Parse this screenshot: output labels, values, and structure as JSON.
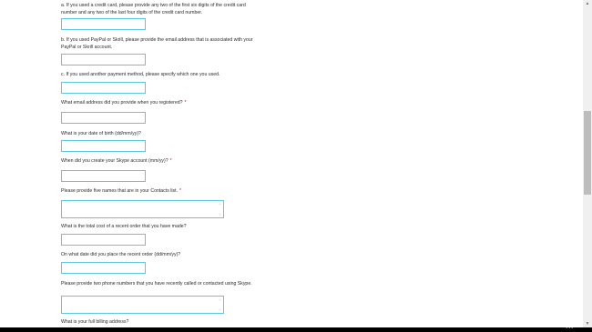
{
  "form": {
    "q_card": {
      "label": "a. If you used a credit card, please provide any two of the first six digits of the credit card number and any two of the last four digits of the credit card number."
    },
    "q_paypal": {
      "label": "b. If you used PayPal or Skrill, please provide the email address that is associated with your PayPal or Skrill account."
    },
    "q_other": {
      "label": "c. If you used another payment method, please specify which one you used."
    },
    "q_email": {
      "label": "What email address did you provide when you registered?",
      "required": "*"
    },
    "q_dob": {
      "label": "What is your date of birth (dd/mm/yy)?"
    },
    "q_created": {
      "label": "When did you create your Skype account (mm/yy)?",
      "required": "*"
    },
    "q_contacts": {
      "label": "Please provide five names that are in your Contacts list.",
      "required": "*"
    },
    "q_cost": {
      "label": "What is the total cost of a recent order that you have made?"
    },
    "q_order_date": {
      "label": "On what date did you place the recent order (dd/mm/yy)?"
    },
    "q_phones": {
      "label": "Please provide two phone numbers that you have recently called or contacted using Skype."
    },
    "q_billing": {
      "label": "What is your full billing address?"
    }
  },
  "textarea_arrows": {
    "up": "˄",
    "down": "˅"
  },
  "scrollbar": {
    "up": "▲",
    "down": "▼",
    "thumb_position": 0.37
  },
  "taskbar": {
    "ellipsis": "•••"
  },
  "colors": {
    "field_border": "#5fc6e8",
    "required": "#d9001b"
  }
}
